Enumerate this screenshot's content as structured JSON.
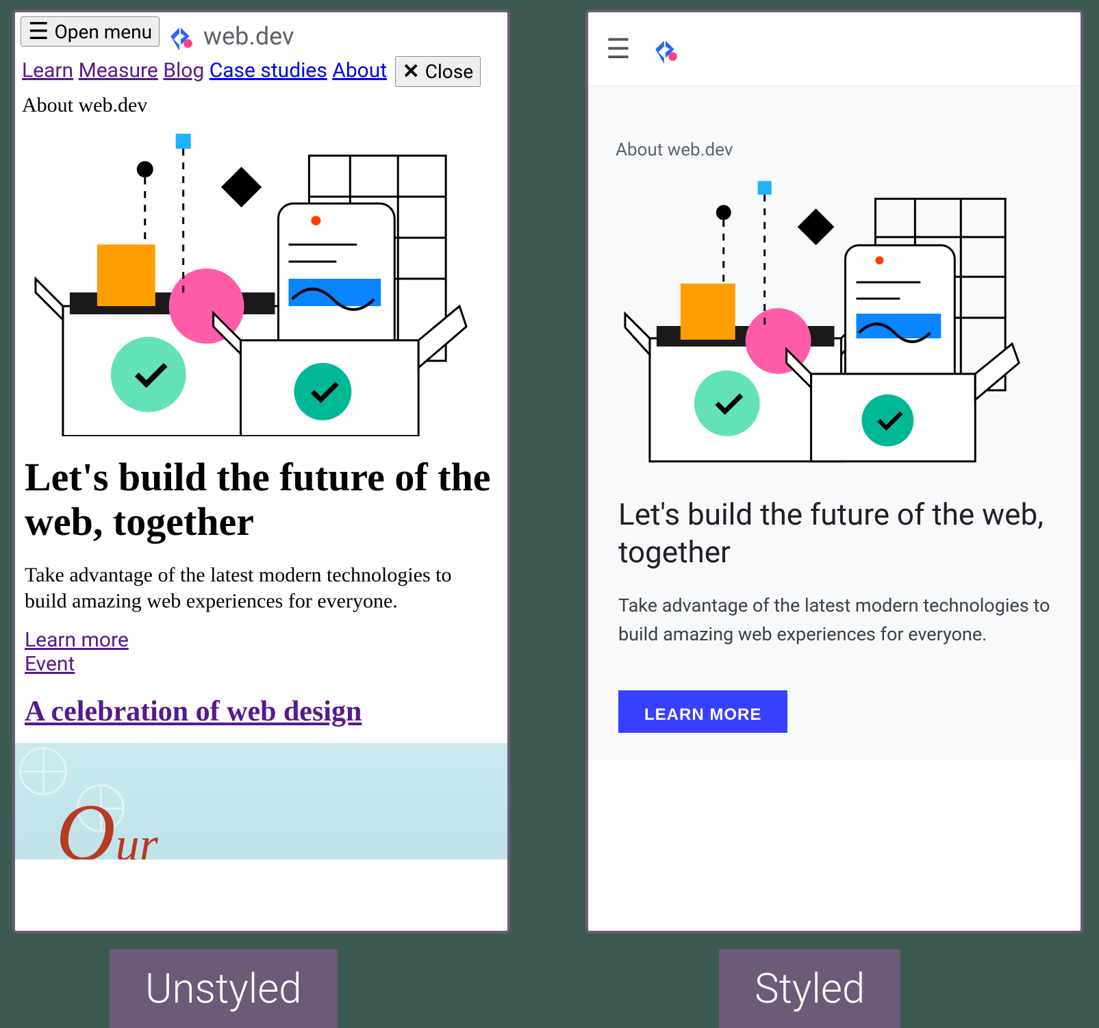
{
  "captions": {
    "unstyled": "Unstyled",
    "styled": "Styled"
  },
  "brand": {
    "name": "web.dev"
  },
  "unstyled": {
    "open_menu": "Open menu",
    "close": "Close",
    "nav": {
      "learn": "Learn",
      "measure": "Measure",
      "blog": "Blog",
      "case_studies": "Case studies",
      "about": "About"
    },
    "about_label": "About web.dev",
    "heading": "Let's build the future of the web, together",
    "tagline": "Take advantage of the latest modern technologies to build amazing web experiences for everyone.",
    "learn_more": "Learn more",
    "event_label": "Event",
    "event_heading": "A celebration of web design"
  },
  "styled": {
    "about_label": "About web.dev",
    "heading": "Let's build the future of the web, together",
    "tagline": "Take advantage of the latest modern technologies to build amazing web experiences for everyone.",
    "cta": "LEARN MORE"
  }
}
